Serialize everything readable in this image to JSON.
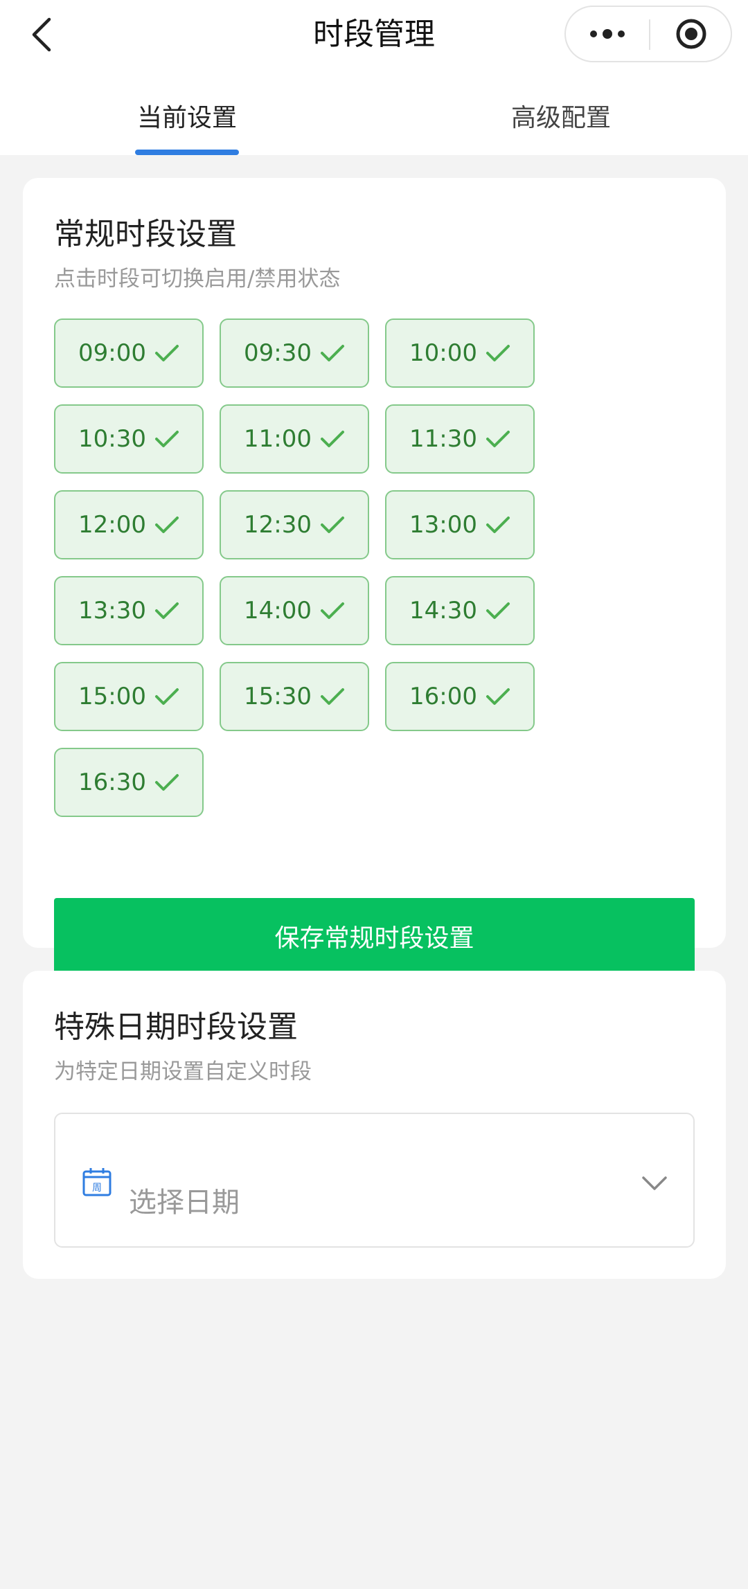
{
  "header": {
    "title": "时段管理",
    "back_icon": "chevron-left-icon",
    "more_icon": "more-dots-icon",
    "close_icon": "target-circle-icon"
  },
  "tabs": [
    {
      "label": "当前设置",
      "active": true
    },
    {
      "label": "高级配置",
      "active": false
    }
  ],
  "regular": {
    "title": "常规时段设置",
    "subtitle": "点击时段可切换启用/禁用状态",
    "slots": [
      {
        "time": "09:00",
        "enabled": true
      },
      {
        "time": "09:30",
        "enabled": true
      },
      {
        "time": "10:00",
        "enabled": true
      },
      {
        "time": "10:30",
        "enabled": true
      },
      {
        "time": "11:00",
        "enabled": true
      },
      {
        "time": "11:30",
        "enabled": true
      },
      {
        "time": "12:00",
        "enabled": true
      },
      {
        "time": "12:30",
        "enabled": true
      },
      {
        "time": "13:00",
        "enabled": true
      },
      {
        "time": "13:30",
        "enabled": true
      },
      {
        "time": "14:00",
        "enabled": true
      },
      {
        "time": "14:30",
        "enabled": true
      },
      {
        "time": "15:00",
        "enabled": true
      },
      {
        "time": "15:30",
        "enabled": true
      },
      {
        "time": "16:00",
        "enabled": true
      },
      {
        "time": "16:30",
        "enabled": true
      }
    ],
    "save_label": "保存常规时段设置"
  },
  "special": {
    "title": "特殊日期时段设置",
    "subtitle": "为特定日期设置自定义时段",
    "date_placeholder": "选择日期",
    "calendar_glyph": "周"
  },
  "colors": {
    "accent_blue": "#2f7de1",
    "primary_green": "#07c160",
    "slot_bg": "#e8f5e9",
    "slot_border": "#84c98a",
    "slot_text": "#2e7d32",
    "check_green": "#4caf50"
  }
}
